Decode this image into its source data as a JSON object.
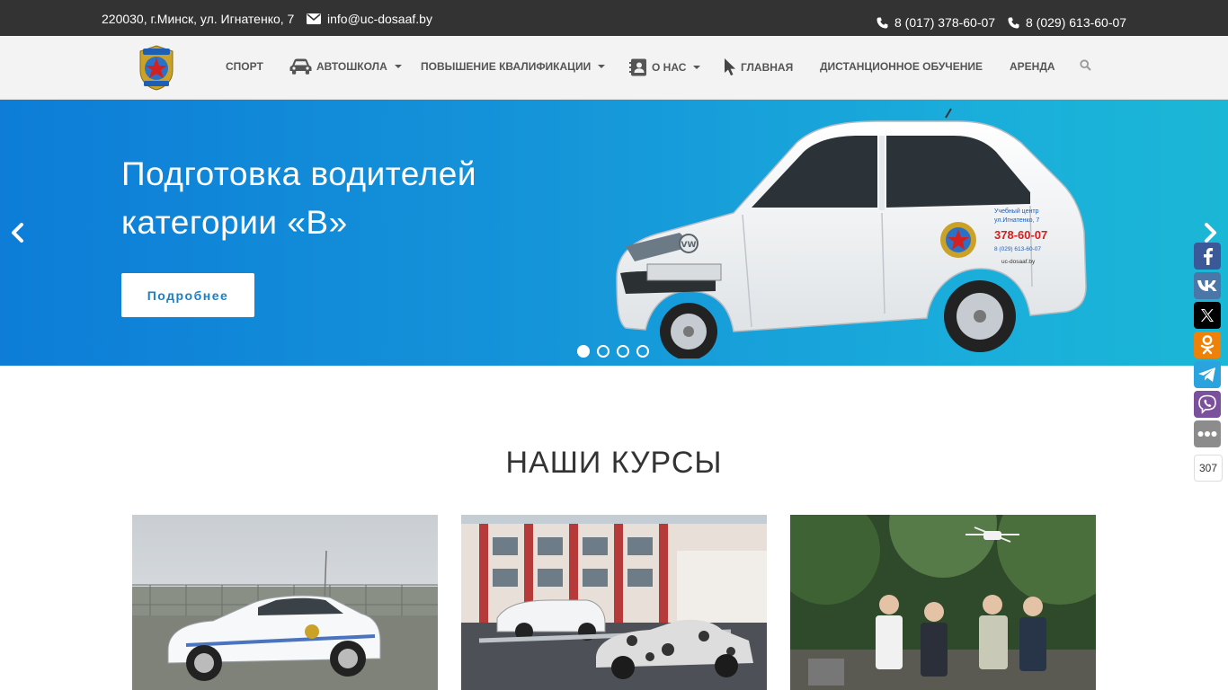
{
  "topbar": {
    "address": "220030, г.Минск, ул. Игнатенко, 7",
    "email": "info@uc-dosaaf.by",
    "phone1": "8 (017) 378-60-07",
    "phone2": "8 (029) 613-60-07"
  },
  "nav": {
    "items": [
      {
        "label": "СПОРТ"
      },
      {
        "label": "АВТОШКОЛА"
      },
      {
        "label": "ПОВЫШЕНИЕ КВАЛИФИКАЦИИ"
      },
      {
        "label": "О НАС"
      },
      {
        "label": "ГЛАВНАЯ"
      },
      {
        "label": "ДИСТАНЦИОННОЕ ОБУЧЕНИЕ"
      },
      {
        "label": "АРЕНДА"
      }
    ]
  },
  "hero": {
    "title_line1": "Подготовка водителей",
    "title_line2": "категории «В»",
    "button": "Подробнее",
    "slides_total": 4,
    "active_slide": 1,
    "car_decal": {
      "line1": "Учебный центр",
      "line2": "ул.Игнатенко, 7",
      "phone": "378-60-07",
      "phone_b": "8 (029) 613-60-07",
      "site": "uc-dosaaf.by"
    }
  },
  "social": {
    "icons": [
      "facebook-icon",
      "vk-icon",
      "x-icon",
      "odnoklassniki-icon",
      "telegram-icon",
      "viber-icon",
      "more-icon"
    ],
    "count": "307"
  },
  "courses": {
    "title": "НАШИ КУРСЫ"
  },
  "colors": {
    "topbar": "#333333",
    "hero_start": "#0d7dd7",
    "hero_end": "#1bb7d6",
    "facebook": "#3b5998",
    "vk": "#4a76a8",
    "x": "#000000",
    "ok": "#ee8208",
    "telegram": "#2aa3df",
    "viber": "#7b519d",
    "more": "#8c8c8c"
  }
}
